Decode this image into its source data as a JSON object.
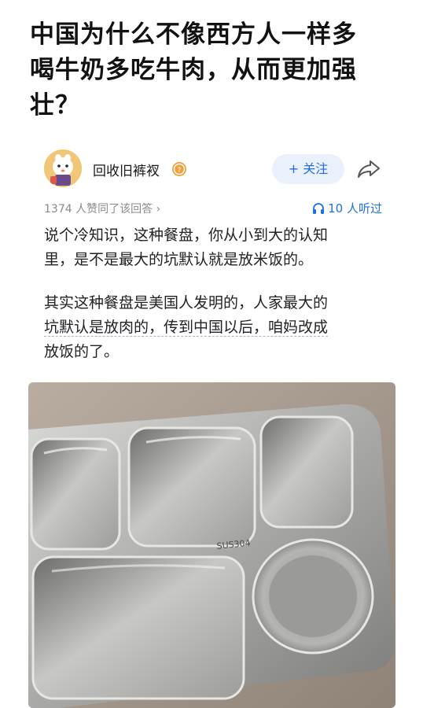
{
  "question": {
    "title_lines": [
      "中国为什么不像西方人一样多",
      "喝牛奶多吃牛肉，从而更加强",
      "壮？"
    ]
  },
  "author": {
    "name": "回收旧裤衩",
    "follow_label": "+ 关注"
  },
  "meta": {
    "likes_text": "1374 人赞同了该回答 ›",
    "listen_text": "10 人听过"
  },
  "answer": {
    "paragraph1_lines": [
      "说个冷知识，这种餐盘，你从小到大的认知",
      "里，是不是最大的坑默认就是放米饭的。"
    ],
    "paragraph2_lines": [
      "其实这种餐盘是美国人发明的，人家最大的",
      "坑默认是放肉的，传到中国以后，咱妈改成",
      "放饭的了。"
    ]
  },
  "photo": {
    "engraving": "SUS304",
    "subject": "five-compartment stainless steel tray"
  },
  "colors": {
    "accent": "#1f6fe5",
    "follow_bg": "#eaf1fd",
    "muted": "#8a8a8a"
  }
}
